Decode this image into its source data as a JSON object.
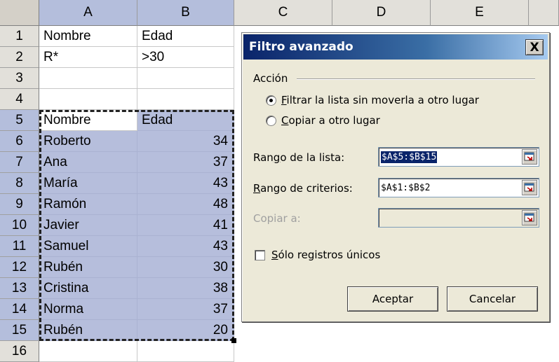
{
  "sheet": {
    "columns": [
      "A",
      "B",
      "C",
      "D",
      "E"
    ],
    "rows": [
      "1",
      "2",
      "3",
      "4",
      "5",
      "6",
      "7",
      "8",
      "9",
      "10",
      "11",
      "12",
      "13",
      "14",
      "15",
      "16"
    ],
    "cells": {
      "a1": "Nombre",
      "b1": "Edad",
      "a2": "R*",
      "b2": ">30",
      "a5": "Nombre",
      "b5": "Edad"
    },
    "data_rows": [
      {
        "name": "Roberto",
        "age": "34"
      },
      {
        "name": "Ana",
        "age": "37"
      },
      {
        "name": "María",
        "age": "43"
      },
      {
        "name": "Ramón",
        "age": "48"
      },
      {
        "name": "Javier",
        "age": "41"
      },
      {
        "name": "Samuel",
        "age": "43"
      },
      {
        "name": "Rubén",
        "age": "30"
      },
      {
        "name": "Cristina",
        "age": "38"
      },
      {
        "name": "Norma",
        "age": "37"
      },
      {
        "name": "Rubén",
        "age": "20"
      }
    ]
  },
  "dialog": {
    "title": "Filtro avanzado",
    "close_label": "X",
    "group_label": "Acción",
    "radio_filter_first": "F",
    "radio_filter_rest": "iltrar la lista sin moverla a otro lugar",
    "radio_copy_first": "C",
    "radio_copy_rest": "opiar a otro lugar",
    "list_range_label_a": "Ran",
    "list_range_label_u": "g",
    "list_range_label_b": "o de la lista:",
    "list_range_value": "$A$5:$B$15",
    "criteria_range_label_u": "R",
    "criteria_range_label_b": "ango de criterios:",
    "criteria_range_value": "$A$1:$B$2",
    "copy_to_label": "Copiar a:",
    "copy_to_value": "",
    "unique_first": "S",
    "unique_rest": "ólo registros únicos",
    "ok_label": "Aceptar",
    "cancel_label": "Cancelar"
  },
  "colors": {
    "selection_fill": "#b6bedc",
    "title_bar": "#0a246a",
    "dialog_bg": "#ece9d8"
  }
}
